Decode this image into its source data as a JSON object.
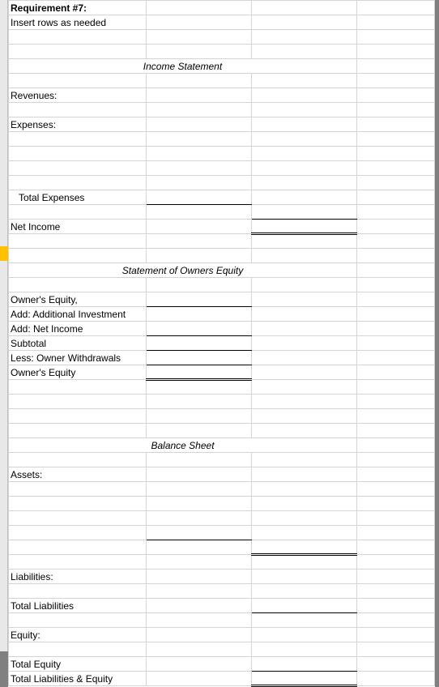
{
  "header": {
    "req_label": "Requirement #7:",
    "req_instruction": "Insert rows as needed"
  },
  "income_statement": {
    "title": "Income Statement",
    "revenues_label": "Revenues:",
    "expenses_label": "Expenses:",
    "total_expenses_label": "Total Expenses",
    "net_income_label": "Net Income"
  },
  "owners_equity": {
    "title": "Statement of Owners Equity",
    "opening_label": "Owner's Equity,",
    "add_investment_label": "Add: Additional Investment",
    "add_net_income_label": "Add: Net Income",
    "subtotal_label": "Subtotal",
    "less_withdrawals_label": "Less: Owner Withdrawals",
    "closing_label": "Owner's Equity"
  },
  "balance_sheet": {
    "title": "Balance Sheet",
    "assets_label": "Assets:",
    "liabilities_label": "Liabilities:",
    "total_liabilities_label": "Total Liabilities",
    "equity_label": "Equity:",
    "total_equity_label": "Total Equity",
    "total_liab_equity_label": "Total Liabilities & Equity"
  }
}
